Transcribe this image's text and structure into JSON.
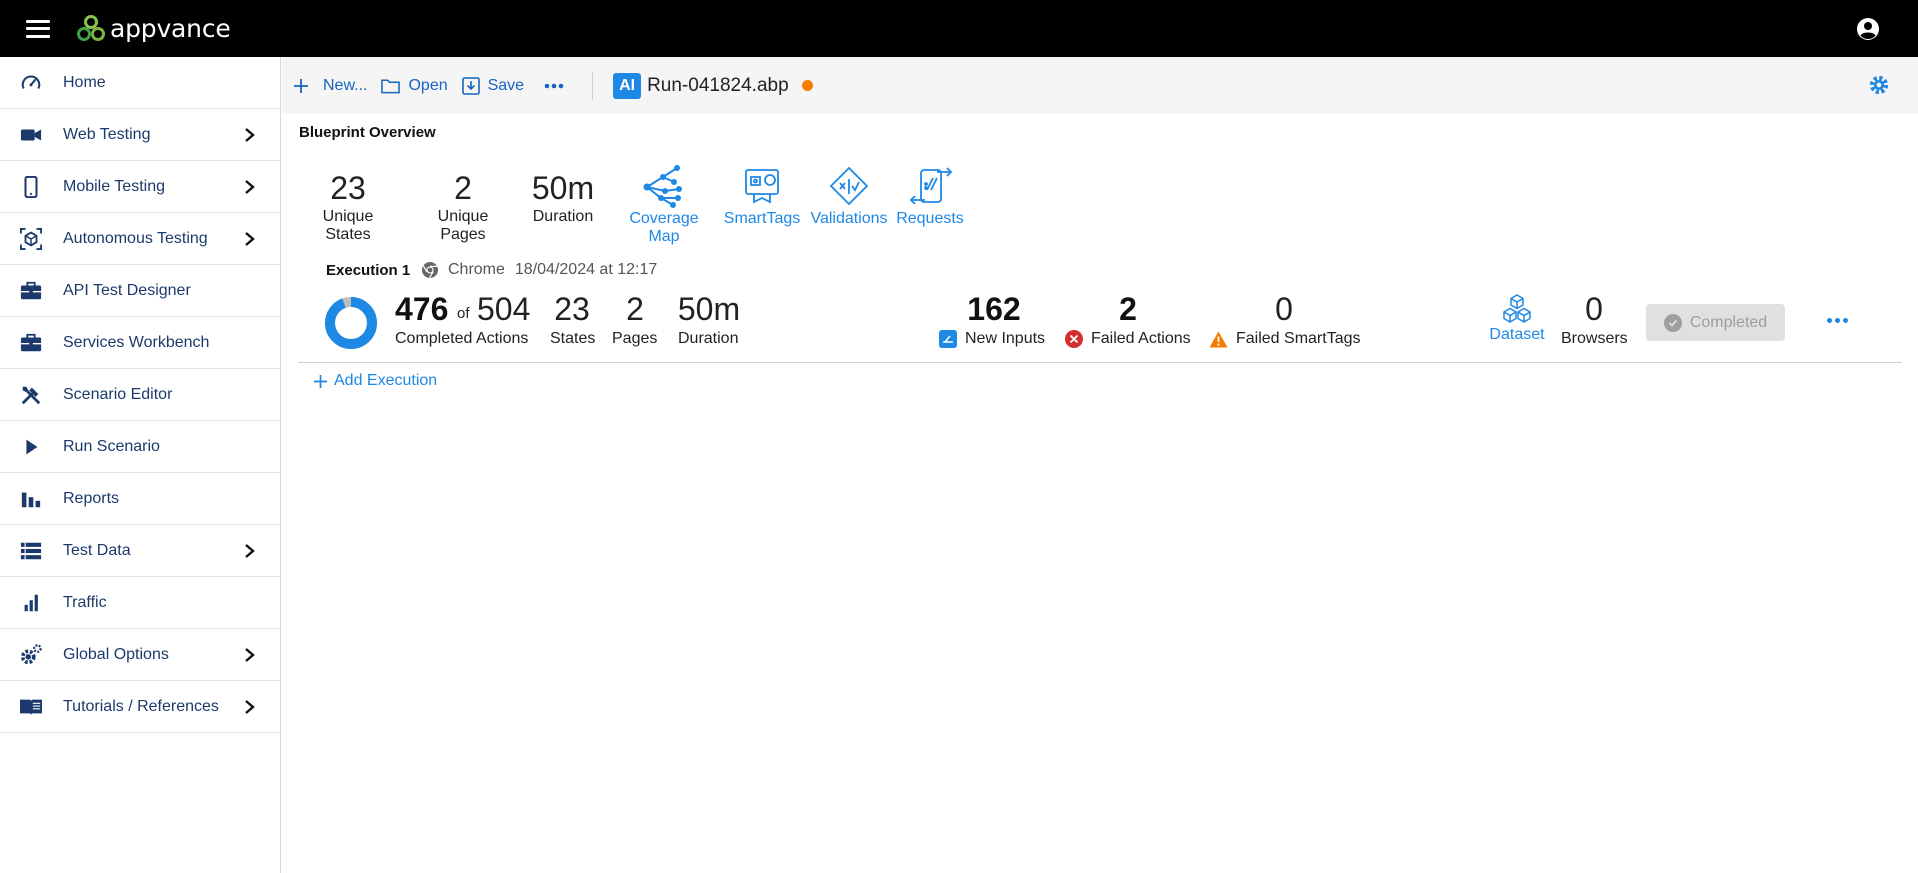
{
  "app": {
    "logo_text": "appvance"
  },
  "sidebar": {
    "items": [
      {
        "label": "Home",
        "icon": "speedometer-icon",
        "has_arrow": false
      },
      {
        "label": "Web Testing",
        "icon": "video-camera-icon",
        "has_arrow": true
      },
      {
        "label": "Mobile Testing",
        "icon": "smartphone-icon",
        "has_arrow": true
      },
      {
        "label": "Autonomous Testing",
        "icon": "autonomous-cube-icon",
        "has_arrow": true
      },
      {
        "label": "API Test Designer",
        "icon": "briefcase-icon",
        "has_arrow": false
      },
      {
        "label": "Services Workbench",
        "icon": "briefcase-icon",
        "has_arrow": false
      },
      {
        "label": "Scenario Editor",
        "icon": "tools-icon",
        "has_arrow": false
      },
      {
        "label": "Run Scenario",
        "icon": "play-icon",
        "has_arrow": false
      },
      {
        "label": "Reports",
        "icon": "bar-chart-icon",
        "has_arrow": false
      },
      {
        "label": "Test Data",
        "icon": "table-rows-icon",
        "has_arrow": true
      },
      {
        "label": "Traffic",
        "icon": "signal-bars-icon",
        "has_arrow": false
      },
      {
        "label": "Global Options",
        "icon": "gears-icon",
        "has_arrow": true
      },
      {
        "label": "Tutorials / References",
        "icon": "book-icon",
        "has_arrow": true
      }
    ]
  },
  "toolbar": {
    "new_label": "New...",
    "open_label": "Open",
    "save_label": "Save",
    "ai_badge": "AI",
    "file_name": "Run-041824.abp"
  },
  "overview": {
    "title": "Blueprint Overview",
    "unique_states": {
      "value": "23",
      "label": "Unique States"
    },
    "unique_pages": {
      "value": "2",
      "label": "Unique Pages"
    },
    "duration": {
      "value": "50m",
      "label": "Duration"
    },
    "links": {
      "coverage_map": "Coverage Map",
      "smarttags": "SmartTags",
      "validations": "Validations",
      "requests": "Requests"
    }
  },
  "execution": {
    "title": "Execution 1",
    "browser": "Chrome",
    "datetime": "18/04/2024 at 12:17",
    "completed": "476",
    "of_word": "of",
    "total": "504",
    "completed_label": "Completed Actions",
    "completed_fraction": 0.944,
    "states": {
      "value": "23",
      "label": "States"
    },
    "pages": {
      "value": "2",
      "label": "Pages"
    },
    "duration": {
      "value": "50m",
      "label": "Duration"
    },
    "new_inputs": {
      "value": "162",
      "label": "New Inputs"
    },
    "failed_actions": {
      "value": "2",
      "label": "Failed Actions"
    },
    "failed_smarttags": {
      "value": "0",
      "label": "Failed SmartTags"
    },
    "dataset_label": "Dataset",
    "browsers": {
      "value": "0",
      "label": "Browsers"
    },
    "status_label": "Completed",
    "add_execution_label": "Add Execution"
  },
  "colors": {
    "accent": "#1e88e5",
    "nav_text": "#1b3a6b",
    "unsaved": "#f57c00",
    "error": "#d32f2f",
    "warning": "#f57c00"
  }
}
